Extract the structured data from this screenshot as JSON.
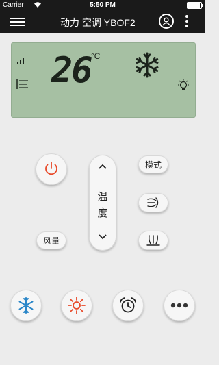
{
  "status_bar": {
    "carrier": "Carrier",
    "time": "5:50 PM",
    "battery_level": 0.95
  },
  "nav": {
    "title": "动力 空调 YBOF2"
  },
  "lcd": {
    "temperature": "26",
    "unit": "°C",
    "background": "#a6c0a3"
  },
  "controls": {
    "power_color": "#e84a2a",
    "mode_label": "模式",
    "fan_speed_label": "风量",
    "temperature_label_top": "温",
    "temperature_label_bottom": "度"
  },
  "bottom_bar": {
    "items": [
      {
        "icon": "snowflake-icon",
        "color": "#2a86c8"
      },
      {
        "icon": "sun-icon",
        "color": "#e84a2a"
      },
      {
        "icon": "alarm-clock-icon",
        "color": "#222222"
      },
      {
        "icon": "ellipsis-icon",
        "color": "#333333"
      }
    ]
  }
}
